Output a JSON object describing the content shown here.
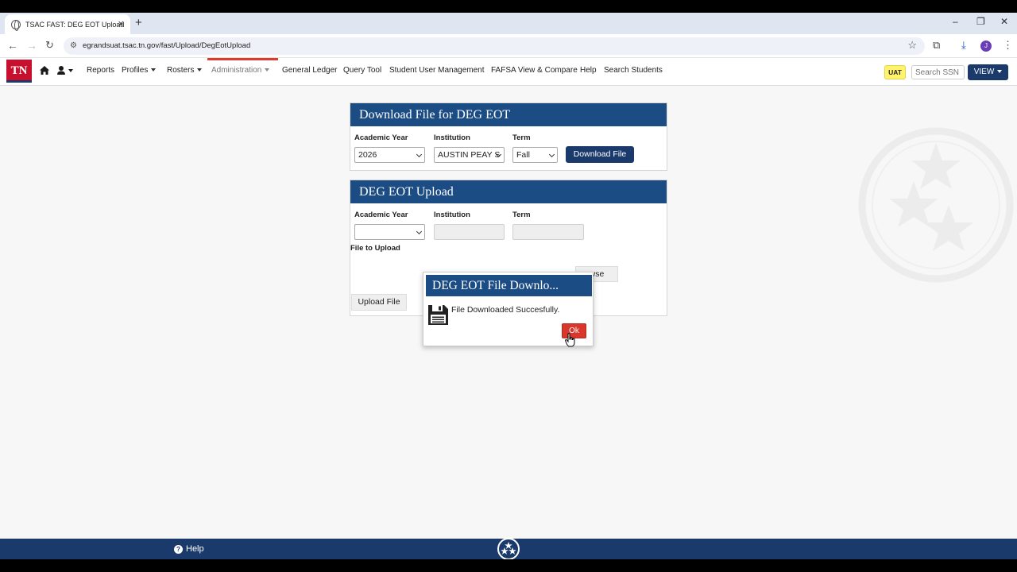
{
  "browser": {
    "tab_title": "TSAC FAST: DEG EOT Upload",
    "url": "egrandsuat.tsac.tn.gov/fast/Upload/DegEotUpload",
    "profile_initial": "J"
  },
  "nav": {
    "logo": "TN",
    "items": [
      "Reports",
      "Profiles",
      "Rosters",
      "Administration",
      "General Ledger",
      "Query Tool",
      "Student User Management",
      "FAFSA View & Compare",
      "Help",
      "Search Students"
    ],
    "env_badge": "UAT",
    "search_placeholder": "Search SSN",
    "view_label": "VIEW"
  },
  "download_panel": {
    "title": "Download File for DEG EOT",
    "academic_year_label": "Academic Year",
    "academic_year_value": "2026",
    "institution_label": "Institution",
    "institution_value": "AUSTIN PEAY S",
    "term_label": "Term",
    "term_value": "Fall",
    "button": "Download File"
  },
  "upload_panel": {
    "title": "DEG EOT Upload",
    "academic_year_label": "Academic Year",
    "institution_label": "Institution",
    "term_label": "Term",
    "file_label": "File to Upload",
    "browse_partial": "wse",
    "button": "Upload File"
  },
  "dialog": {
    "title": "DEG EOT File Downlo...",
    "message": "File Downloaded Succesfully.",
    "ok": "Ok"
  },
  "footer": {
    "help": "Help"
  },
  "colors": {
    "navy": "#1a3a6b",
    "panel_header": "#1c4c84",
    "tn_red": "#c8102e",
    "ok_red": "#d9372b",
    "uat_yellow": "#fff36b"
  }
}
